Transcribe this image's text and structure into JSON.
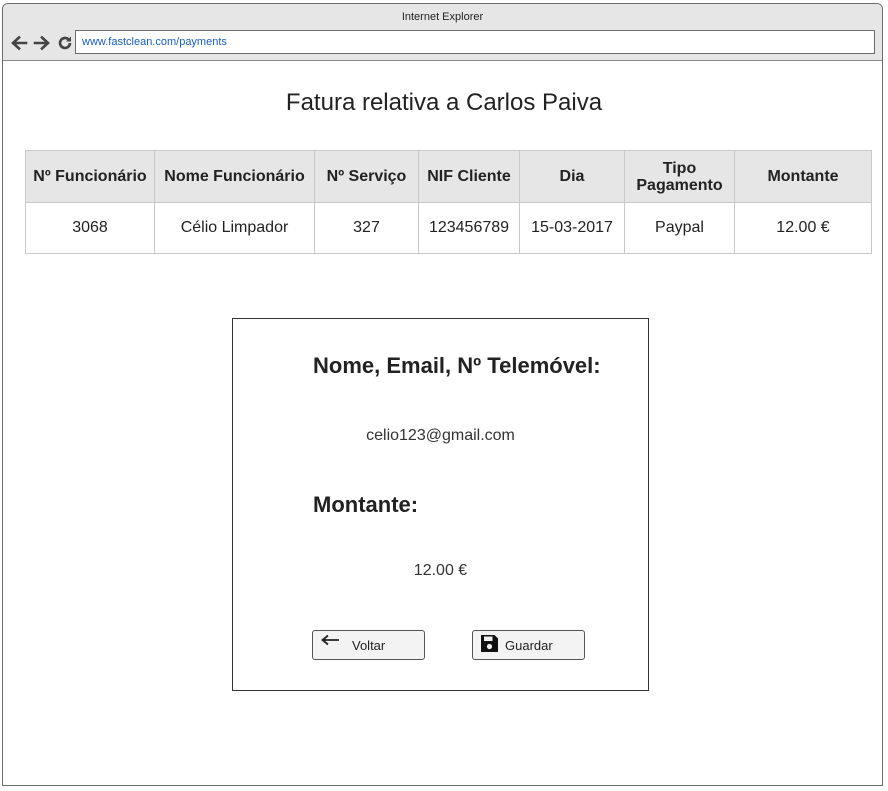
{
  "browser": {
    "title": "Internet Explorer",
    "url": "www.fastclean.com/payments"
  },
  "page": {
    "title": "Fatura relativa a Carlos Paiva"
  },
  "table": {
    "headers": [
      "Nº Funcionário",
      "Nome Funcionário",
      "Nº Serviço",
      "NIF Cliente",
      "Dia",
      "Tipo Pagamento",
      "Montante"
    ],
    "rows": [
      [
        "3068",
        "Célio Limpador",
        "327",
        "123456789",
        "15-03-2017",
        "Paypal",
        "12.00 €"
      ]
    ]
  },
  "panel": {
    "contact_heading": "Nome, Email, Nº Telemóvel:",
    "contact_value": "celio123@gmail.com",
    "amount_heading": "Montante:",
    "amount_value": "12.00 €",
    "back_label": "Voltar",
    "save_label": "Guardar"
  },
  "icons": {
    "back": "arrow-left-icon",
    "forward": "arrow-right-icon",
    "refresh": "refresh-icon",
    "voltar": "arrow-left-icon",
    "guardar": "floppy-disk-icon"
  }
}
